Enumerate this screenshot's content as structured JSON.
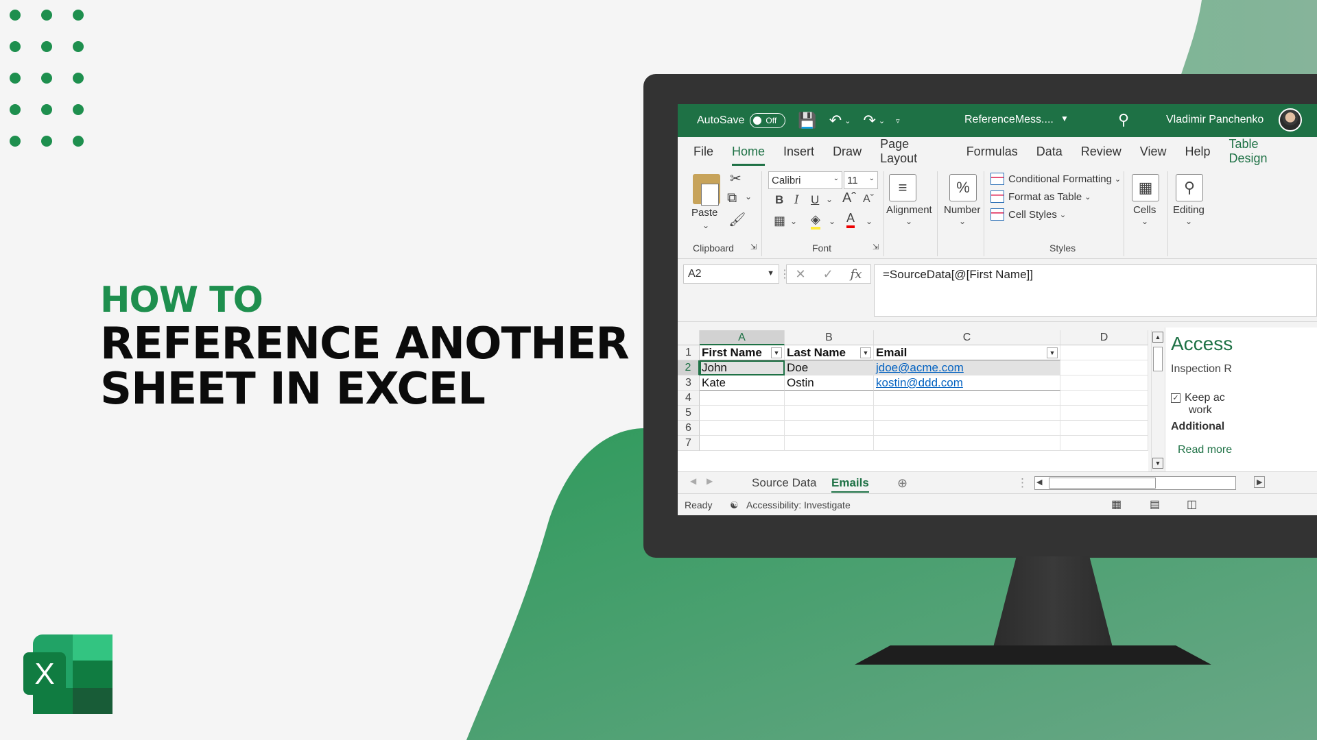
{
  "headline": {
    "eyebrow": "HOW TO",
    "line1": "REFERENCE ANOTHER",
    "line2": "SHEET IN EXCEL"
  },
  "colors": {
    "brand_green": "#1e8f4e",
    "excel_green": "#1e7145",
    "link_blue": "#0563c1"
  },
  "titlebar": {
    "autosave_label": "AutoSave",
    "autosave_state": "Off",
    "doc_name": "ReferenceMess....",
    "user_name": "Vladimir Panchenko"
  },
  "menu": {
    "items": [
      "File",
      "Home",
      "Insert",
      "Draw",
      "Page Layout",
      "Formulas",
      "Data",
      "Review",
      "View",
      "Help",
      "Table Design"
    ],
    "active": "Home"
  },
  "ribbon": {
    "paste_label": "Paste",
    "clipboard_label": "Clipboard",
    "font_name": "Calibri",
    "font_size": "11",
    "font_label": "Font",
    "alignment_label": "Alignment",
    "number_label": "Number",
    "conditional_formatting": "Conditional Formatting",
    "format_as_table": "Format as Table",
    "cell_styles": "Cell Styles",
    "styles_label": "Styles",
    "cells_label": "Cells",
    "editing_label": "Editing"
  },
  "formula_bar": {
    "name_box": "A2",
    "formula": "=SourceData[@[First Name]]"
  },
  "sheet": {
    "columns": [
      "A",
      "B",
      "C",
      "D"
    ],
    "rows": [
      "1",
      "2",
      "3",
      "4",
      "5",
      "6",
      "7"
    ],
    "header": [
      "First Name",
      "Last Name",
      "Email"
    ],
    "data": [
      [
        "John",
        "Doe",
        "jdoe@acme.com"
      ],
      [
        "Kate",
        "Ostin",
        "kostin@ddd.com"
      ]
    ]
  },
  "side_pane": {
    "title": "Access",
    "subtitle": "Inspection R",
    "check_line1": "Keep ac",
    "check_line2": "work",
    "additional": "Additional",
    "read_more": "Read more"
  },
  "tabs": {
    "items": [
      "Source Data",
      "Emails"
    ],
    "active": "Emails"
  },
  "status": {
    "ready": "Ready",
    "accessibility": "Accessibility: Investigate"
  }
}
